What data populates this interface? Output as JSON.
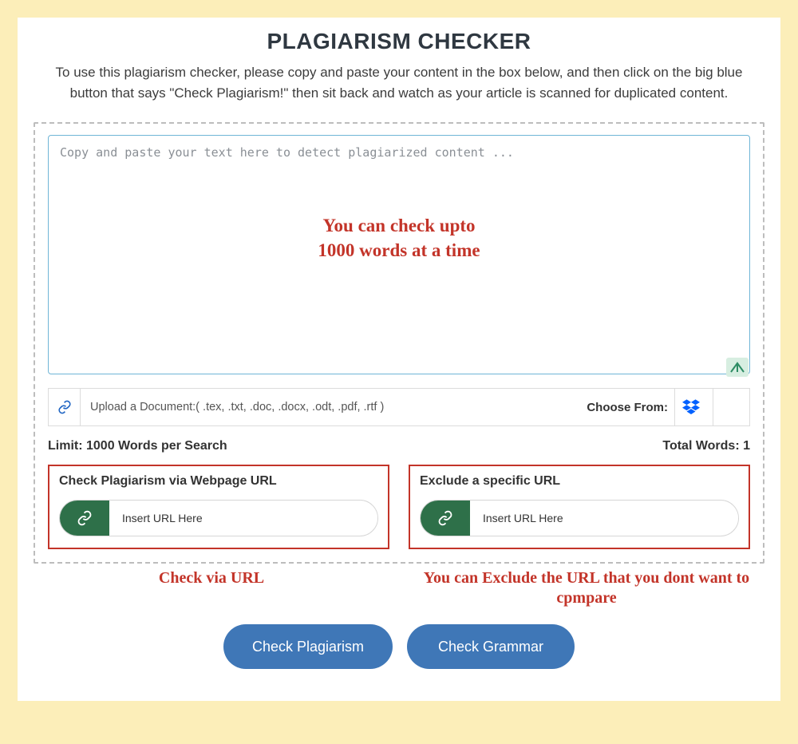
{
  "title": "PLAGIARISM CHECKER",
  "subtitle": "To use this plagiarism checker, please copy and paste your content in the box below, and then click on the big blue button that says \"Check Plagiarism!\" then sit back and watch as your article is scanned for duplicated content.",
  "textarea": {
    "placeholder": "Copy and paste your text here to detect plagiarized content ...",
    "value": ""
  },
  "annotations": {
    "words_limit": "You can check upto\n1000 words at a time",
    "check_via_url": "Check via URL",
    "exclude_url": "You can Exclude the URL that you dont want to cpmpare"
  },
  "upload": {
    "label": "Upload a Document:( .tex, .txt, .doc, .docx, .odt, .pdf, .rtf )",
    "choose_from": "Choose From:"
  },
  "limits": {
    "left": "Limit: 1000 Words per Search",
    "right": "Total Words: 1"
  },
  "url_sections": {
    "check": {
      "title": "Check Plagiarism via Webpage URL",
      "placeholder": "Insert URL Here"
    },
    "exclude": {
      "title": "Exclude a specific URL",
      "placeholder": "Insert URL Here"
    }
  },
  "buttons": {
    "check_plagiarism": "Check Plagiarism",
    "check_grammar": "Check Grammar"
  }
}
